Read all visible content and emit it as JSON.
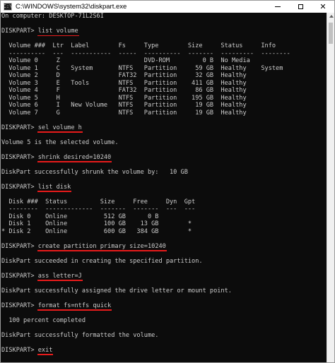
{
  "window": {
    "title": "C:\\WINDOWS\\system32\\diskpart.exe",
    "icon_glyph": "C:\\",
    "icons": [
      "console-app-icon",
      "minimize-icon",
      "maximize-icon",
      "close-icon",
      "scroll-up-arrow-icon"
    ],
    "colors": {
      "console_bg": "#0c0c0c",
      "console_text": "#cccccc",
      "underline": "#e81b1b"
    }
  },
  "console": {
    "lines": [
      "On computer: DESKTOP-71L2S6I",
      "",
      {
        "prompt": "DISKPART> ",
        "cmd": "list volume"
      },
      "",
      "  Volume ###  Ltr  Label        Fs     Type        Size     Status     Info",
      "  ----------  ---  -----------  -----  ----------  -------  ---------  --------",
      "  Volume 0     Z                       DVD-ROM         0 B  No Media",
      "  Volume 1     C   System       NTFS   Partition     59 GB  Healthy    System",
      "  Volume 2     D                FAT32  Partition     32 GB  Healthy",
      "  Volume 3     E   Tools        NTFS   Partition    411 GB  Healthy",
      "  Volume 4     F                FAT32  Partition     86 GB  Healthy",
      "  Volume 5     H                NTFS   Partition    195 GB  Healthy",
      "  Volume 6     I   New Volume   NTFS   Partition     19 GB  Healthy",
      "  Volume 7     G                NTFS   Partition     19 GB  Healthy",
      "",
      {
        "prompt": "DISKPART> ",
        "cmd": "sel volume h"
      },
      "",
      "Volume 5 is the selected volume.",
      "",
      {
        "prompt": "DISKPART> ",
        "cmd": "shrink desired=10240"
      },
      "",
      "DiskPart successfully shrunk the volume by:   10 GB",
      "",
      {
        "prompt": "DISKPART> ",
        "cmd": "list disk"
      },
      "",
      "  Disk ###  Status         Size     Free     Dyn  Gpt",
      "  --------  -------------  -------  -------  ---  ---",
      "  Disk 0    Online          512 GB      0 B",
      "  Disk 1    Online          100 GB    13 GB        *",
      "* Disk 2    Online          600 GB   384 GB        *",
      "",
      {
        "prompt": "DISKPART> ",
        "cmd": "create partition primary size=10240"
      },
      "",
      "DiskPart succeeded in creating the specified partition.",
      "",
      {
        "prompt": "DISKPART> ",
        "cmd": "ass letter=J"
      },
      "",
      "DiskPart successfully assigned the drive letter or mount point.",
      "",
      {
        "prompt": "DISKPART> ",
        "cmd": "format fs=ntfs quick"
      },
      "",
      "  100 percent completed",
      "",
      "DiskPart successfully formatted the volume.",
      "",
      {
        "prompt": "DISKPART> ",
        "cmd": "exit"
      }
    ]
  }
}
